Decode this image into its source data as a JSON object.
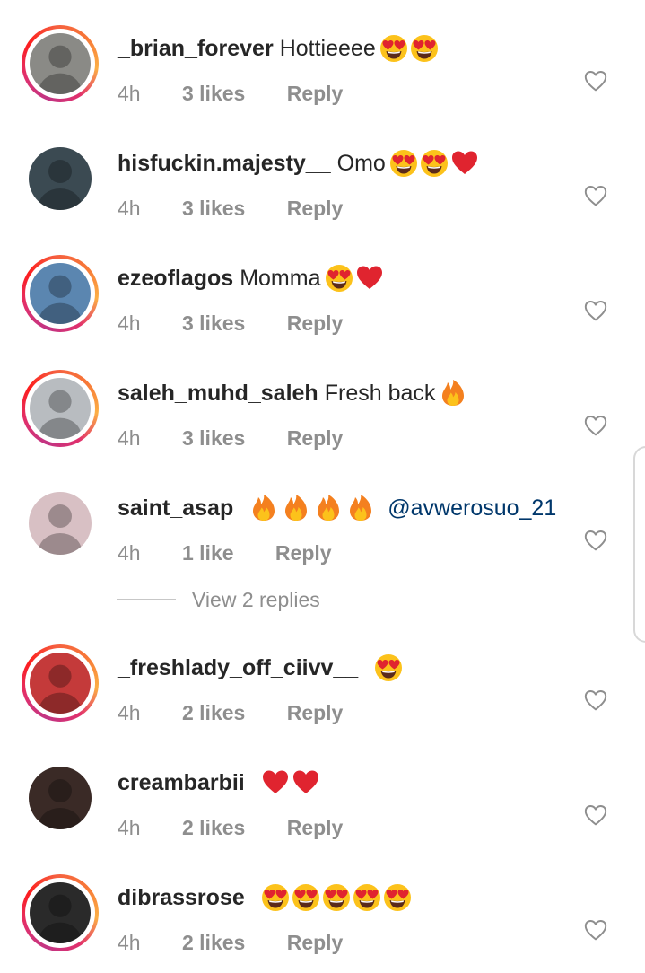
{
  "colors": {
    "text": "#262626",
    "secondary": "#8e8e8e",
    "mention": "#00376b",
    "heart_red": "#e0242f"
  },
  "comments": [
    {
      "username": "_brian_forever",
      "text": "Hottieeee",
      "emojis": [
        "heart-eyes",
        "heart-eyes"
      ],
      "time": "4h",
      "likes": "3 likes",
      "reply": "Reply",
      "story_ring": true
    },
    {
      "username": "hisfuckin.majesty__",
      "text": "Omo",
      "emojis": [
        "heart-eyes",
        "heart-eyes",
        "red-heart"
      ],
      "time": "4h",
      "likes": "3 likes",
      "reply": "Reply",
      "story_ring": false
    },
    {
      "username": "ezeoflagos",
      "text": "Momma",
      "emojis": [
        "heart-eyes",
        "red-heart"
      ],
      "time": "4h",
      "likes": "3 likes",
      "reply": "Reply",
      "story_ring": true
    },
    {
      "username": "saleh_muhd_saleh",
      "text": "Fresh back",
      "emojis": [
        "fire"
      ],
      "time": "4h",
      "likes": "3 likes",
      "reply": "Reply",
      "story_ring": true
    },
    {
      "username": "saint_asap",
      "text": "",
      "emojis": [
        "fire",
        "fire",
        "fire",
        "fire"
      ],
      "mention": "@avwerosuo_21",
      "time": "4h",
      "likes": "1 like",
      "reply": "Reply",
      "story_ring": false
    },
    {
      "username": "_freshlady_off_ciivv__",
      "text": "",
      "emojis": [
        "heart-eyes"
      ],
      "time": "4h",
      "likes": "2 likes",
      "reply": "Reply",
      "story_ring": true
    },
    {
      "username": "creambarbii",
      "text": "",
      "emojis": [
        "red-heart",
        "red-heart"
      ],
      "time": "4h",
      "likes": "2 likes",
      "reply": "Reply",
      "story_ring": false
    },
    {
      "username": "dibrassrose",
      "text": "",
      "emojis": [
        "heart-eyes",
        "heart-eyes",
        "heart-eyes",
        "heart-eyes",
        "heart-eyes"
      ],
      "time": "4h",
      "likes": "2 likes",
      "reply": "Reply",
      "story_ring": true
    }
  ],
  "view_replies": "View 2 replies",
  "avatar_tints": [
    "#8a8a86",
    "#3b4a52",
    "#5b86b0",
    "#b8bcc0",
    "#d8c0c4",
    "#c43a3a",
    "#3a2a26",
    "#2a2a2a"
  ]
}
